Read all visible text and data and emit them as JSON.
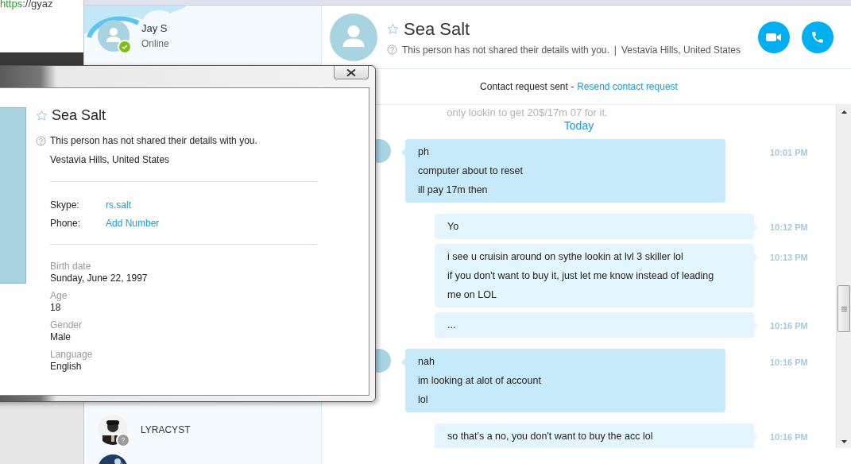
{
  "browser": {
    "url_scheme": "https",
    "url_rest": "://gyaz"
  },
  "profile": {
    "name": "Jay S",
    "status": "Online",
    "online": true
  },
  "contacts": [
    {
      "name": "LYRACYST",
      "online": false,
      "kind": "picture"
    }
  ],
  "header": {
    "name": "Sea Salt",
    "favorite": false,
    "details_note": "This person has not shared their details with you.",
    "separator": "|",
    "location": "Vestavia Hills, United States"
  },
  "request_bar": {
    "text": "Contact request sent -",
    "link": "Resend contact request"
  },
  "chat": {
    "faded_message": "only lookin to get 20$/17m 07 for it.",
    "day": "Today",
    "messages": [
      {
        "outgoing": false,
        "lines": [
          "ph",
          "computer about to reset",
          "ill pay 17m then"
        ],
        "time": "10:01 PM"
      },
      {
        "outgoing": true,
        "lines": [
          "Yo"
        ],
        "time": "10:12 PM"
      },
      {
        "outgoing": true,
        "lines": [
          "i see u cruisin around on sythe lookin at lvl 3 skiller lol",
          "if you don't want to buy it, just let me know instead of leading me on LOL"
        ],
        "time": "10:13 PM"
      },
      {
        "outgoing": true,
        "lines": [
          "..."
        ],
        "time": "10:16 PM"
      },
      {
        "outgoing": false,
        "lines": [
          "nah",
          "im looking at alot of account",
          "lol"
        ],
        "time": "10:16 PM"
      },
      {
        "outgoing": true,
        "lines": [
          "so that's a no, you don't want to buy the acc lol"
        ],
        "time": "10:16 PM"
      }
    ]
  },
  "profile_dialog": {
    "name": "Sea Salt",
    "favorite": false,
    "details_note": "This person has not shared their details with you.",
    "location": "Vestavia Hills, United States",
    "accounts": [
      {
        "label": "Skype:",
        "value": "rs.salt"
      },
      {
        "label": "Phone:",
        "value": "Add Number"
      }
    ],
    "fields": [
      {
        "label": "Birth date",
        "value": "Sunday, June 22, 1997"
      },
      {
        "label": "Age",
        "value": "18"
      },
      {
        "label": "Gender",
        "value": "Male"
      },
      {
        "label": "Language",
        "value": "English"
      }
    ]
  }
}
